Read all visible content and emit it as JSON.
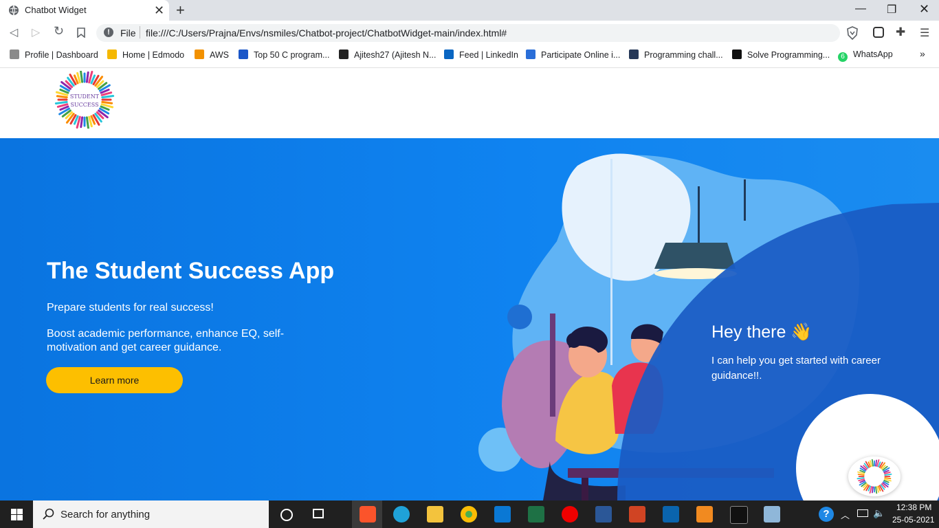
{
  "browser": {
    "tab_title": "Chatbot Widget",
    "omnibox": {
      "scheme_label": "File",
      "url": "file:///C:/Users/Prajna/Envs/nsmiles/Chatbot-project/ChatbotWidget-main/index.html#"
    },
    "bookmarks": [
      {
        "label": "Profile | Dashboard",
        "color": "#8a8a8a"
      },
      {
        "label": "Home | Edmodo",
        "color": "#f5b800"
      },
      {
        "label": "AWS",
        "color": "#f29100"
      },
      {
        "label": "Top 50 C program...",
        "color": "#1a56c8"
      },
      {
        "label": "Ajitesh27 (Ajitesh N...",
        "color": "#222222"
      },
      {
        "label": "Feed | LinkedIn",
        "color": "#0a66c2"
      },
      {
        "label": "Participate Online i...",
        "color": "#2a6ed8"
      },
      {
        "label": "Programming chall...",
        "color": "#253858"
      },
      {
        "label": "Solve Programming...",
        "color": "#111111"
      },
      {
        "label": "WhatsApp",
        "color": "#25d366"
      }
    ],
    "whatsapp_badge": "6"
  },
  "site": {
    "logo_text": [
      "STUDENT",
      "SUCCESS"
    ],
    "hero": {
      "title": "The Student Success App",
      "subtitle": "Prepare students for real success!",
      "description": "Boost academic performance, enhance EQ, self-motivation and get career guidance.",
      "cta_label": "Learn more"
    },
    "chat": {
      "greeting": "Hey there",
      "greeting_emoji": "👋",
      "message": "I can help you get started with career guidance!!."
    }
  },
  "taskbar": {
    "search_placeholder": "Search for anything",
    "time": "12:38 PM",
    "date": "25-05-2021"
  },
  "colors": {
    "hero_blue": "#0f83f0",
    "chat_blue": "#1a5bc4",
    "cta_yellow": "#fdbf00"
  }
}
